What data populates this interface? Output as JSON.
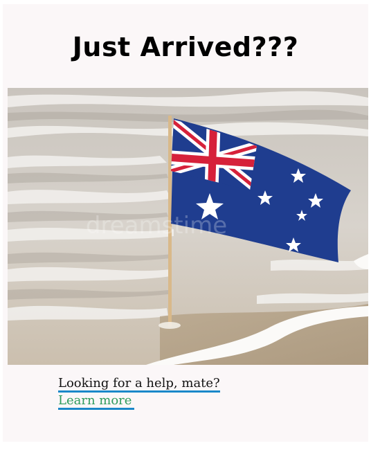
{
  "page": {
    "title": "Just Arrived???",
    "question": "Looking for a help, mate?",
    "link_label": "Learn more"
  },
  "image": {
    "watermark": "dreamstime"
  },
  "colors": {
    "card_background": "#fbf7f8",
    "underline": "#1a88c9",
    "link": "#2e9b5c",
    "flag_blue": "#1f3d8f",
    "flag_red": "#d6213a"
  },
  "icons": {
    "flag": "australian-flag"
  }
}
